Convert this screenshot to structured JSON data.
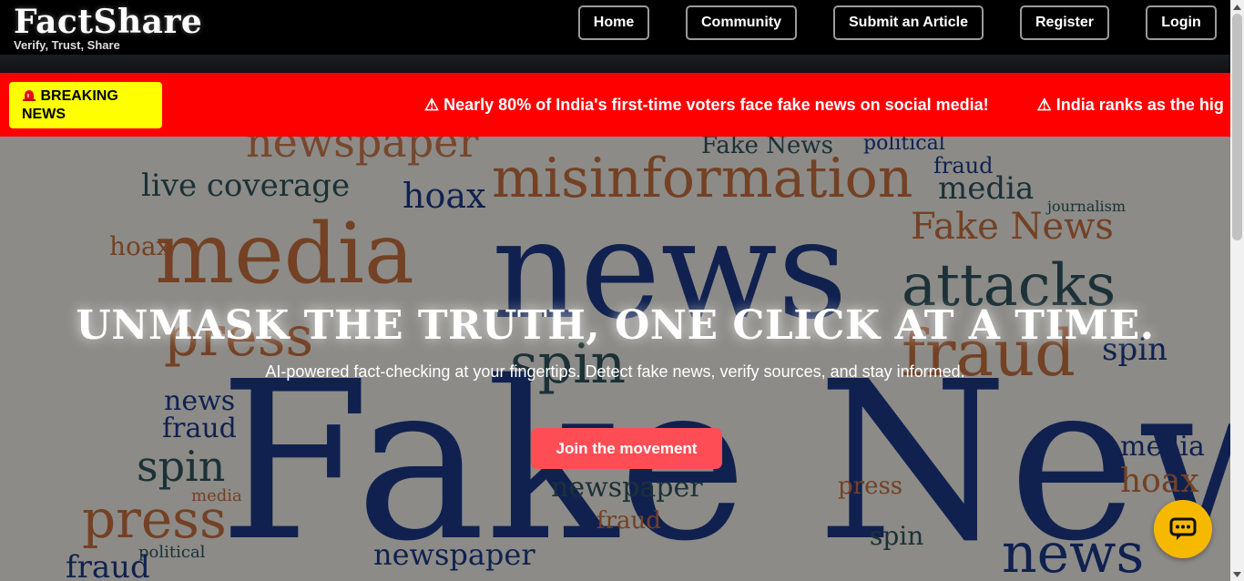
{
  "header": {
    "logo_title": "FactShare",
    "logo_tagline": "Verify, Trust, Share",
    "nav": [
      "Home",
      "Community",
      "Submit an Article",
      "Register",
      "Login"
    ]
  },
  "breaking": {
    "badge_label": "BREAKING NEWS",
    "siren_icon": "siren-icon",
    "headlines": [
      "⚠ Nearly 80% of India's first-time voters face fake news on social media!",
      "⚠ India ranks as the hig"
    ]
  },
  "hero": {
    "title": "UNMASK THE TRUTH, ONE CLICK AT A TIME.",
    "subtitle": "AI-powered fact-checking at your fingertips. Detect fake news, verify sources, and stay informed.",
    "cta_label": "Join the movement"
  },
  "word_cloud_text": [
    "newspaper",
    "Fake News",
    "political",
    "misinformation",
    "fraud",
    "live coverage",
    "media",
    "hoax",
    "journalism",
    "news",
    "attacks",
    "press",
    "spin",
    "Fake News",
    "newspaper",
    "political",
    "fraud",
    "spin",
    "hoax"
  ],
  "chat": {
    "icon": "chat-bubble-icon"
  },
  "colors": {
    "breaking_bar": "#ff0000",
    "badge": "#ffff00",
    "cta": "#ff4d55",
    "chat_fab": "#f7b800",
    "cloud_blue": "#1d3a8a",
    "cloud_orange": "#c8703f",
    "cloud_teal": "#2f5560"
  }
}
